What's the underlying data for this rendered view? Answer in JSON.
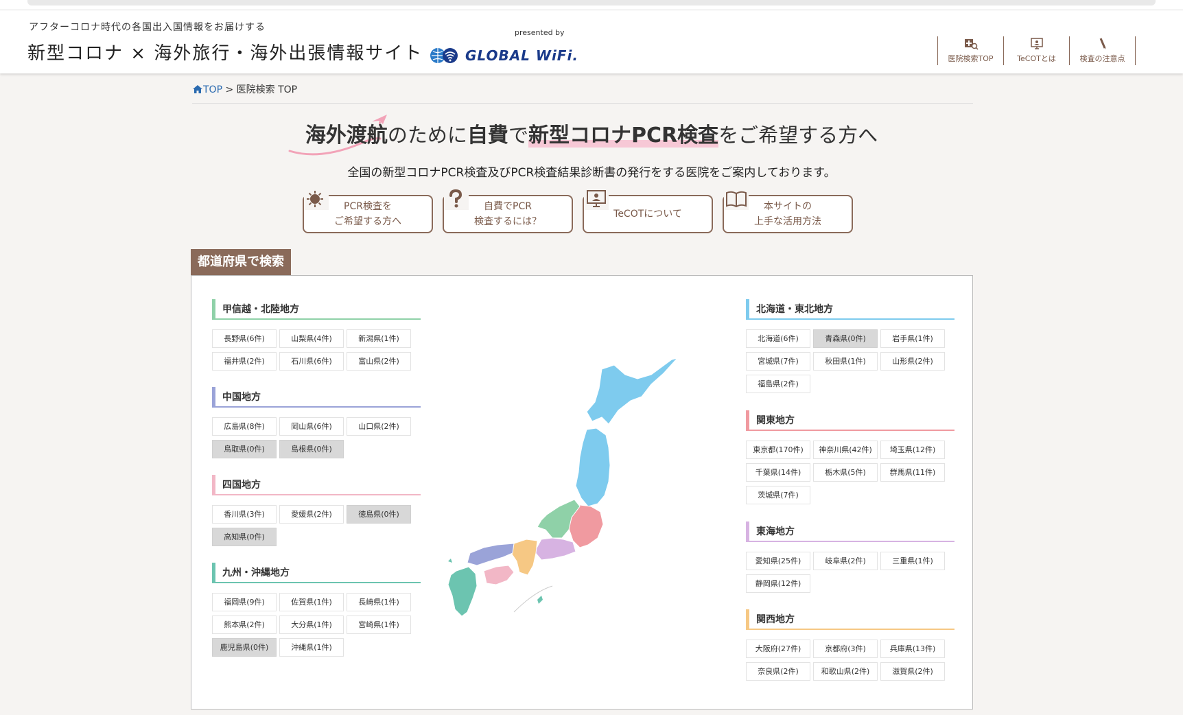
{
  "header": {
    "tagline": "アフターコロナ時代の各国出入国情報をお届けする",
    "title": "新型コロナ × 海外旅行・海外出張情報サイト",
    "logo_presented": "presented by",
    "logo_brand": "GLOBAL WiFi.",
    "nav": [
      {
        "label": "医院検索TOP",
        "icon": "hospital-search-icon"
      },
      {
        "label": "TeCOTとは",
        "icon": "monitor-icon"
      },
      {
        "label": "検査の注意点",
        "icon": "pen-icon"
      }
    ]
  },
  "breadcrumb": {
    "home": "TOP",
    "separator": ">",
    "current": "医院検索 TOP"
  },
  "headline": {
    "p1": "海外渡航",
    "p2": "のために",
    "p3": "自費",
    "p4": "で",
    "p5": "新型コロナPCR検査",
    "p6": "をご希望する方へ"
  },
  "subline": "全国の新型コロナPCR検査及びPCR検査結果診断書の発行をする医院をご案内しております。",
  "features": [
    {
      "line1": "PCR検査を",
      "line2": "ご希望する方へ",
      "icon": "virus-icon"
    },
    {
      "line1": "自費でPCR",
      "line2": "検査するには？",
      "icon": "question-icon"
    },
    {
      "line1": "TeCOTについて",
      "line2": "",
      "icon": "monitor-icon"
    },
    {
      "line1": "本サイトの",
      "line2": "上手な活用方法",
      "icon": "book-icon"
    }
  ],
  "section_label": "都道府県で検索",
  "regions_left": [
    {
      "title": "甲信越・北陸地方",
      "color": "#8fd1a8",
      "prefs": [
        {
          "label": "長野県(6件)",
          "empty": false
        },
        {
          "label": "山梨県(4件)",
          "empty": false
        },
        {
          "label": "新潟県(1件)",
          "empty": false
        },
        {
          "label": "福井県(2件)",
          "empty": false
        },
        {
          "label": "石川県(6件)",
          "empty": false
        },
        {
          "label": "富山県(2件)",
          "empty": false
        }
      ]
    },
    {
      "title": "中国地方",
      "color": "#9aa3d8",
      "prefs": [
        {
          "label": "広島県(8件)",
          "empty": false
        },
        {
          "label": "岡山県(6件)",
          "empty": false
        },
        {
          "label": "山口県(2件)",
          "empty": false
        },
        {
          "label": "鳥取県(0件)",
          "empty": true
        },
        {
          "label": "島根県(0件)",
          "empty": true
        }
      ]
    },
    {
      "title": "四国地方",
      "color": "#f2b7c6",
      "prefs": [
        {
          "label": "香川県(3件)",
          "empty": false
        },
        {
          "label": "愛媛県(2件)",
          "empty": false
        },
        {
          "label": "徳島県(0件)",
          "empty": true
        },
        {
          "label": "高知県(0件)",
          "empty": true
        }
      ]
    },
    {
      "title": "九州・沖縄地方",
      "color": "#6cc4b0",
      "prefs": [
        {
          "label": "福岡県(9件)",
          "empty": false
        },
        {
          "label": "佐賀県(1件)",
          "empty": false
        },
        {
          "label": "長崎県(1件)",
          "empty": false
        },
        {
          "label": "熊本県(2件)",
          "empty": false
        },
        {
          "label": "大分県(1件)",
          "empty": false
        },
        {
          "label": "宮崎県(1件)",
          "empty": false
        },
        {
          "label": "鹿児島県(0件)",
          "empty": true
        },
        {
          "label": "沖縄県(1件)",
          "empty": false
        }
      ]
    }
  ],
  "regions_right": [
    {
      "title": "北海道・東北地方",
      "color": "#7ecbee",
      "prefs": [
        {
          "label": "北海道(6件)",
          "empty": false
        },
        {
          "label": "青森県(0件)",
          "empty": true
        },
        {
          "label": "岩手県(1件)",
          "empty": false
        },
        {
          "label": "宮城県(7件)",
          "empty": false
        },
        {
          "label": "秋田県(1件)",
          "empty": false
        },
        {
          "label": "山形県(2件)",
          "empty": false
        },
        {
          "label": "福島県(2件)",
          "empty": false
        }
      ]
    },
    {
      "title": "関東地方",
      "color": "#f09aa0",
      "prefs": [
        {
          "label": "東京都(170件)",
          "empty": false
        },
        {
          "label": "神奈川県(42件)",
          "empty": false
        },
        {
          "label": "埼玉県(12件)",
          "empty": false
        },
        {
          "label": "千葉県(14件)",
          "empty": false
        },
        {
          "label": "栃木県(5件)",
          "empty": false
        },
        {
          "label": "群馬県(11件)",
          "empty": false
        },
        {
          "label": "茨城県(7件)",
          "empty": false
        }
      ]
    },
    {
      "title": "東海地方",
      "color": "#d7b3e2",
      "prefs": [
        {
          "label": "愛知県(25件)",
          "empty": false
        },
        {
          "label": "岐阜県(2件)",
          "empty": false
        },
        {
          "label": "三重県(1件)",
          "empty": false
        },
        {
          "label": "静岡県(12件)",
          "empty": false
        }
      ]
    },
    {
      "title": "関西地方",
      "color": "#f6c884",
      "prefs": [
        {
          "label": "大阪府(27件)",
          "empty": false
        },
        {
          "label": "京都府(3件)",
          "empty": false
        },
        {
          "label": "兵庫県(13件)",
          "empty": false
        },
        {
          "label": "奈良県(2件)",
          "empty": false
        },
        {
          "label": "和歌山県(2件)",
          "empty": false
        },
        {
          "label": "滋賀県(2件)",
          "empty": false
        }
      ]
    }
  ],
  "map_colors": {
    "hokkaido_tohoku": "#7ecbee",
    "kanto": "#f09aa0",
    "koshinetsu": "#8fd1a8",
    "tokai": "#d7b3e2",
    "kansai": "#f6c884",
    "chugoku": "#9aa3d8",
    "shikoku": "#f2b7c6",
    "kyushu": "#6cc4b0"
  }
}
